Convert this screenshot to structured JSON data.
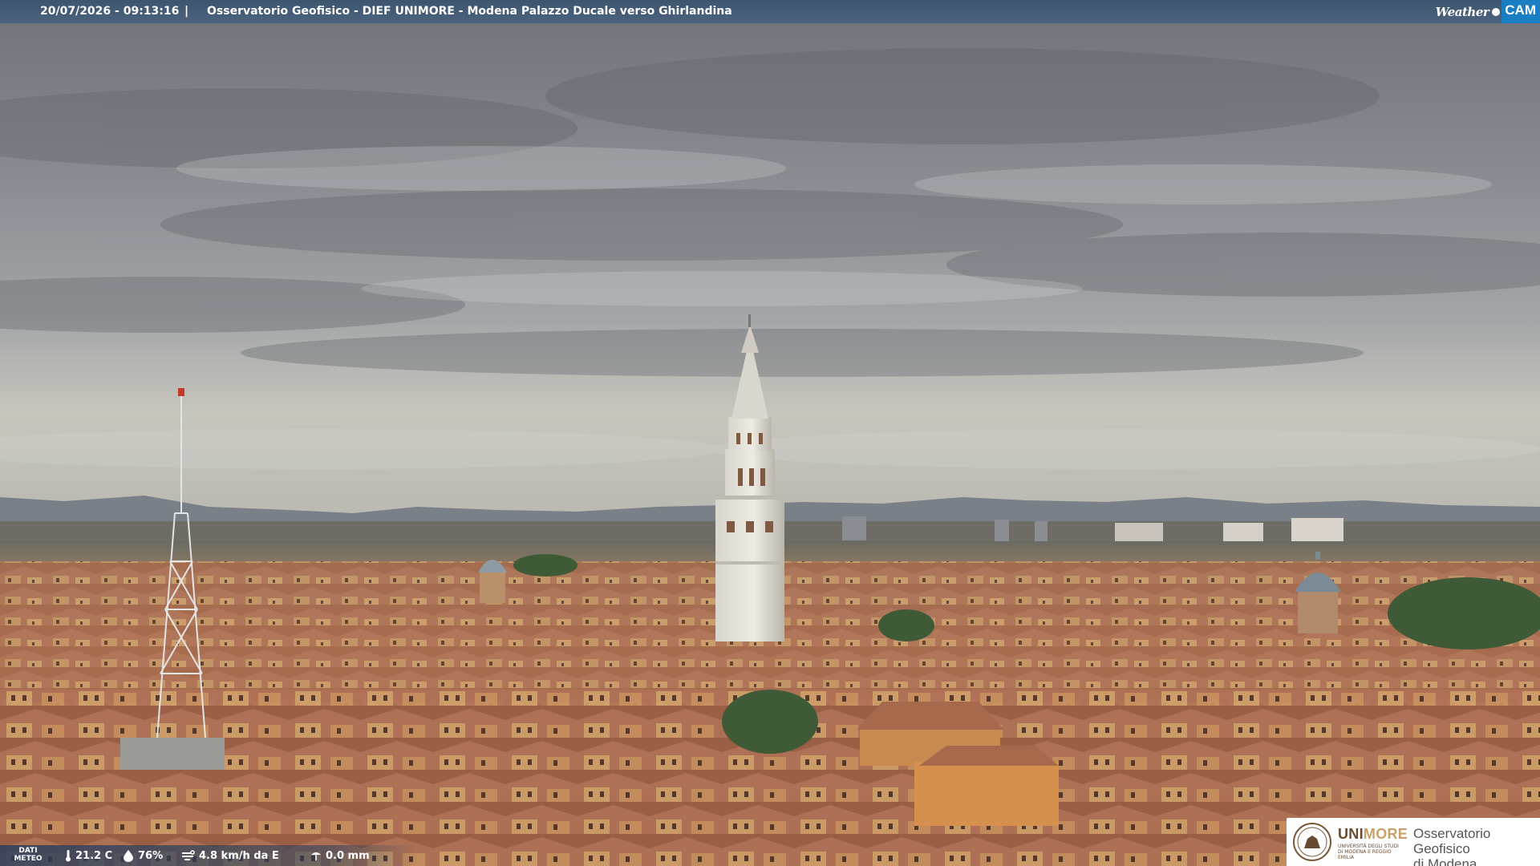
{
  "topbar": {
    "timestamp": "20/07/2026 - 09:13:16",
    "separator": "|",
    "title": "Osservatorio Geofisico - DIEF UNIMORE - Modena Palazzo Ducale verso Ghirlandina"
  },
  "brand": {
    "weather": "Weather",
    "cam": "CAM"
  },
  "meteo": {
    "label_line1": "DATI",
    "label_line2": "METEO",
    "temperature": "21.2 C",
    "humidity": "76%",
    "wind": "4.8 km/h da E",
    "rain": "0.0 mm",
    "icons": [
      "thermometer-icon",
      "humidity-drop-icon",
      "wind-icon",
      "rain-icon"
    ]
  },
  "logo": {
    "uni": "UNI",
    "more": "MORE",
    "uni_sub": "UNIVERSITÀ DEGLI STUDI DI MODENA E REGGIO EMILIA",
    "name_line1": "Osservatorio Geofisico",
    "name_line2": "di Modena"
  },
  "colors": {
    "sky": "#8c9096",
    "roofs": "#a8674a",
    "walls": "#c99a68",
    "bar": "#3a526e",
    "brand_blue": "#1a7fc2"
  }
}
